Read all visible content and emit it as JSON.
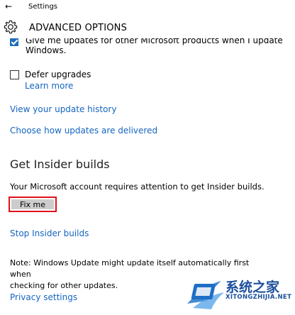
{
  "topbar": {
    "back_glyph": "←",
    "title": "Settings"
  },
  "header": {
    "title": "ADVANCED OPTIONS",
    "icon": "gear-icon"
  },
  "options": {
    "other_products_line1": "Give me updates for other Microsoft products when I update",
    "other_products_line2": "Windows.",
    "other_products_checked": true,
    "defer_label": "Defer upgrades",
    "defer_checked": false,
    "learn_more": "Learn more"
  },
  "links": {
    "history": "View your update history",
    "delivery": "Choose how updates are delivered"
  },
  "insider": {
    "heading": "Get Insider builds",
    "message": "Your Microsoft account requires attention to get Insider builds.",
    "fix_button": "Fix me",
    "stop_link": "Stop Insider builds"
  },
  "note": {
    "line1": "Note: Windows Update might update itself automatically first when",
    "line2": "checking for other updates."
  },
  "footer": {
    "privacy_link": "Privacy settings"
  },
  "watermark": {
    "site_cn": "系统之家",
    "site_en": "XITONGZHIJIA.NET"
  },
  "colors": {
    "accent": "#1565c0",
    "highlight_border": "#e0101c",
    "button_bg": "#cccccc",
    "checkbox_checked": "#1e6fba"
  }
}
